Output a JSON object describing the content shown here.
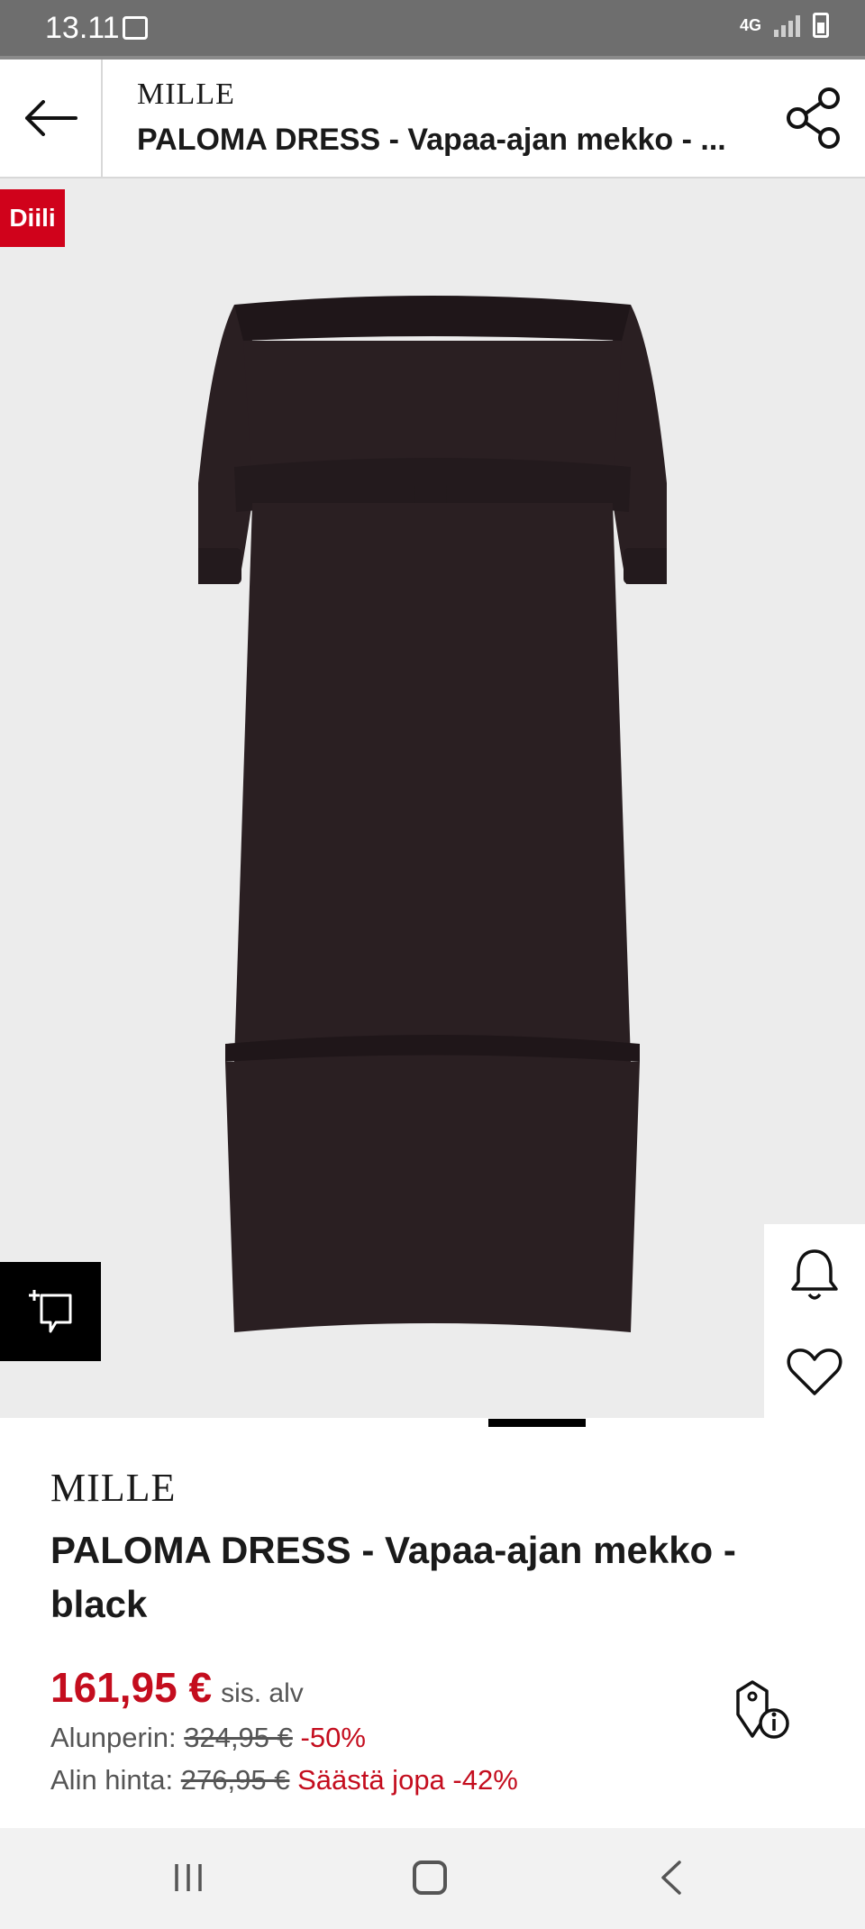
{
  "status_bar": {
    "time": "13.11",
    "network": "4G"
  },
  "header": {
    "brand": "MILLE",
    "title": "PALOMA DRESS - Vapaa-ajan mekko - ..."
  },
  "image": {
    "badge": "Diili",
    "background_color": "#ececec",
    "dress_color": "#2a1f22"
  },
  "product": {
    "brand": "MILLE",
    "name": "PALOMA DRESS - Vapaa-ajan mekko - black"
  },
  "price": {
    "current": "161,95 €",
    "vat_note": "sis. alv",
    "original_label": "Alunperin:",
    "original_value": "324,95 €",
    "original_discount": "-50%",
    "lowest_label": "Alin hinta:",
    "lowest_value": "276,95 €",
    "lowest_saving": "Säästä jopa -42%",
    "accent_color": "#c40d1e"
  },
  "icons": {
    "back": "arrow-left-icon",
    "share": "share-icon",
    "ar": "ar-camera-icon",
    "bell": "bell-icon",
    "heart": "heart-icon",
    "price_info": "price-tag-info-icon"
  }
}
